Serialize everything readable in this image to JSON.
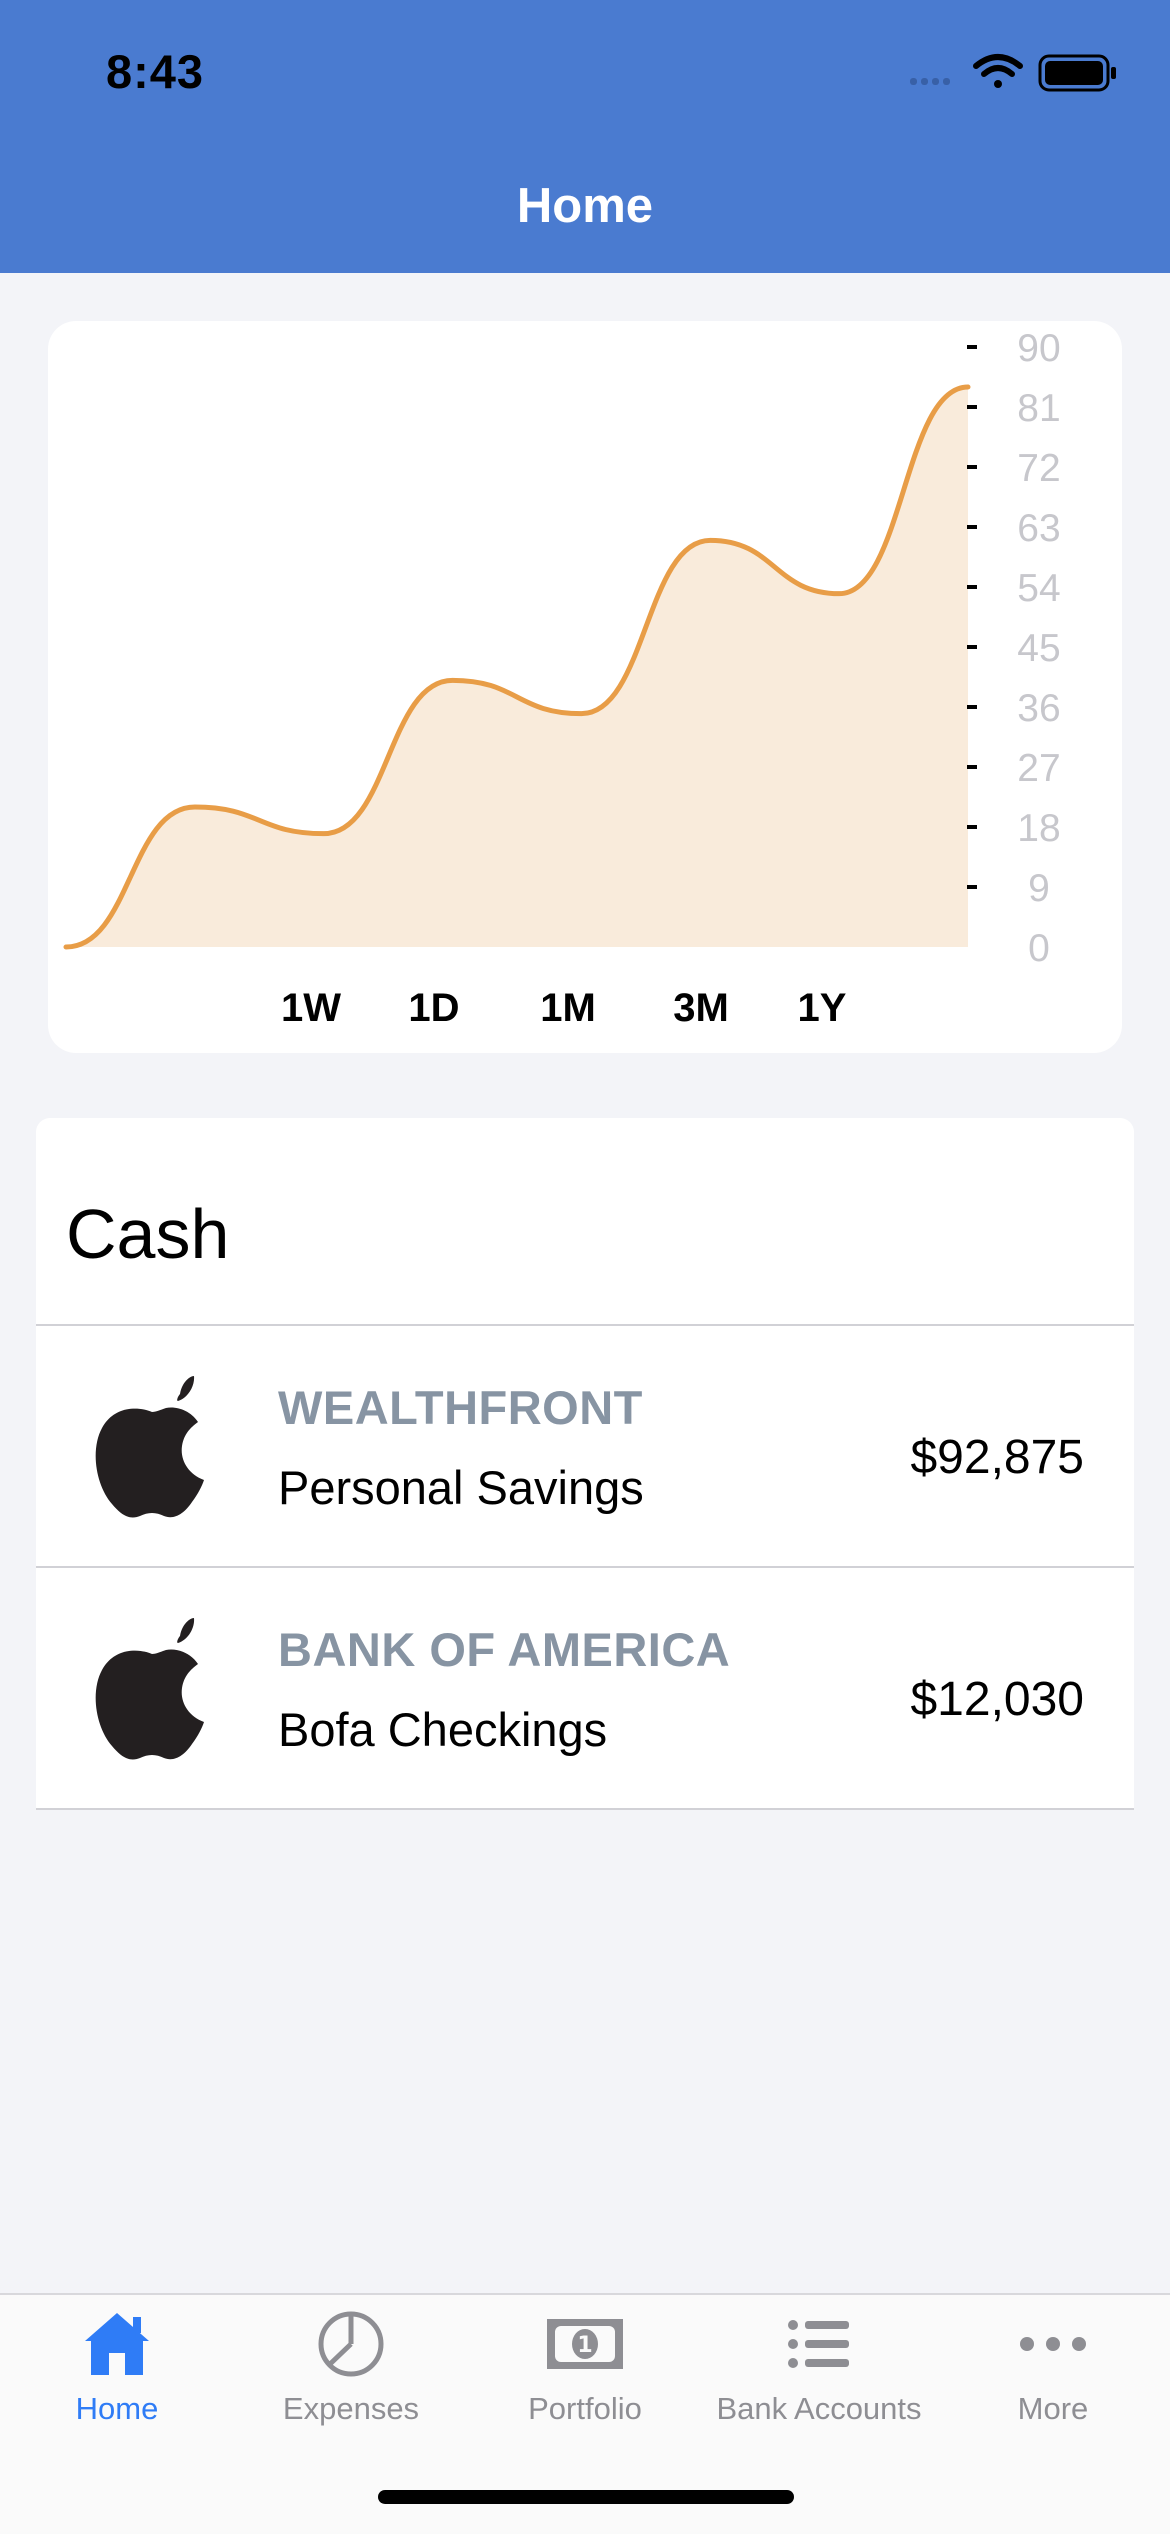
{
  "status_bar": {
    "time": "8:43",
    "icons": [
      "signal-icon",
      "wifi-icon",
      "battery-icon"
    ]
  },
  "nav": {
    "title": "Home"
  },
  "colors": {
    "header_bg": "#4a7bd0",
    "chart_line": "#e89d47",
    "chart_fill": "#f9ebdb",
    "institution_text": "#8794a3",
    "tab_active": "#2f7cf6",
    "tab_inactive": "#8e8e93"
  },
  "chart_data": {
    "type": "area",
    "x": [
      0,
      1,
      2,
      3,
      4,
      5,
      6,
      7,
      8,
      9,
      10
    ],
    "values": [
      0,
      21,
      17,
      40,
      35,
      61,
      53,
      84
    ],
    "ylim": [
      0,
      90
    ],
    "y_ticks": [
      "0",
      "9",
      "18",
      "27",
      "36",
      "45",
      "54",
      "63",
      "72",
      "81",
      "90"
    ],
    "y_axis_position": "right",
    "range_options": [
      "1W",
      "1D",
      "1M",
      "3M",
      "1Y"
    ],
    "grid": false
  },
  "cash": {
    "title": "Cash",
    "accounts": [
      {
        "institution": "WEALTHFRONT",
        "name": "Personal Savings",
        "balance": "$92,875",
        "icon": "apple-icon"
      },
      {
        "institution": "BANK OF AMERICA",
        "name": "Bofa Checkings",
        "balance": "$12,030",
        "icon": "apple-icon"
      }
    ]
  },
  "tabs": [
    {
      "label": "Home",
      "icon": "house-icon",
      "active": true
    },
    {
      "label": "Expenses",
      "icon": "pie-chart-icon",
      "active": false
    },
    {
      "label": "Portfolio",
      "icon": "banknote-icon",
      "active": false
    },
    {
      "label": "Bank Accounts",
      "icon": "list-icon",
      "active": false
    },
    {
      "label": "More",
      "icon": "ellipsis-icon",
      "active": false
    }
  ]
}
